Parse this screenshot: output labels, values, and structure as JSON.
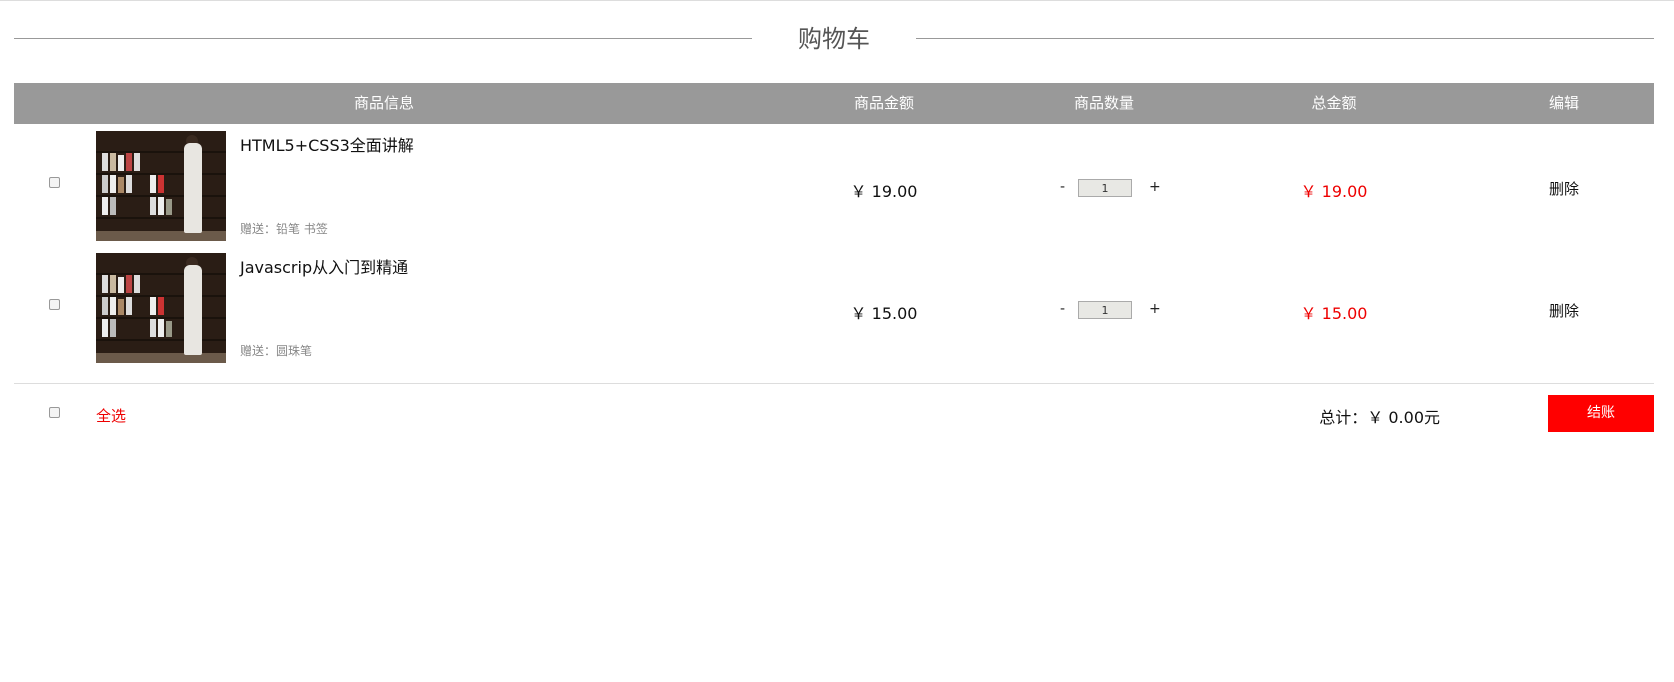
{
  "header": {
    "title": "购物车"
  },
  "columns": {
    "info": "商品信息",
    "price": "商品金额",
    "qty": "商品数量",
    "total": "总金额",
    "edit": "编辑"
  },
  "items": [
    {
      "name": "HTML5+CSS3全面讲解",
      "gift": "赠送：铅笔  书签",
      "price": "￥ 19.00",
      "qty": "1",
      "total": "￥ 19.00",
      "delete": "删除",
      "minus": "-",
      "plus": "+"
    },
    {
      "name": "Javascrip从入门到精通",
      "gift": "赠送：圆珠笔",
      "price": "￥ 15.00",
      "qty": "1",
      "total": "￥ 15.00",
      "delete": "删除",
      "minus": "-",
      "plus": "+"
    }
  ],
  "footer": {
    "select_all": "全选",
    "sum": "总计：￥ 0.00元",
    "checkout": "结账"
  },
  "colors": {
    "accent": "#ff0000",
    "header_bg": "#999999"
  }
}
